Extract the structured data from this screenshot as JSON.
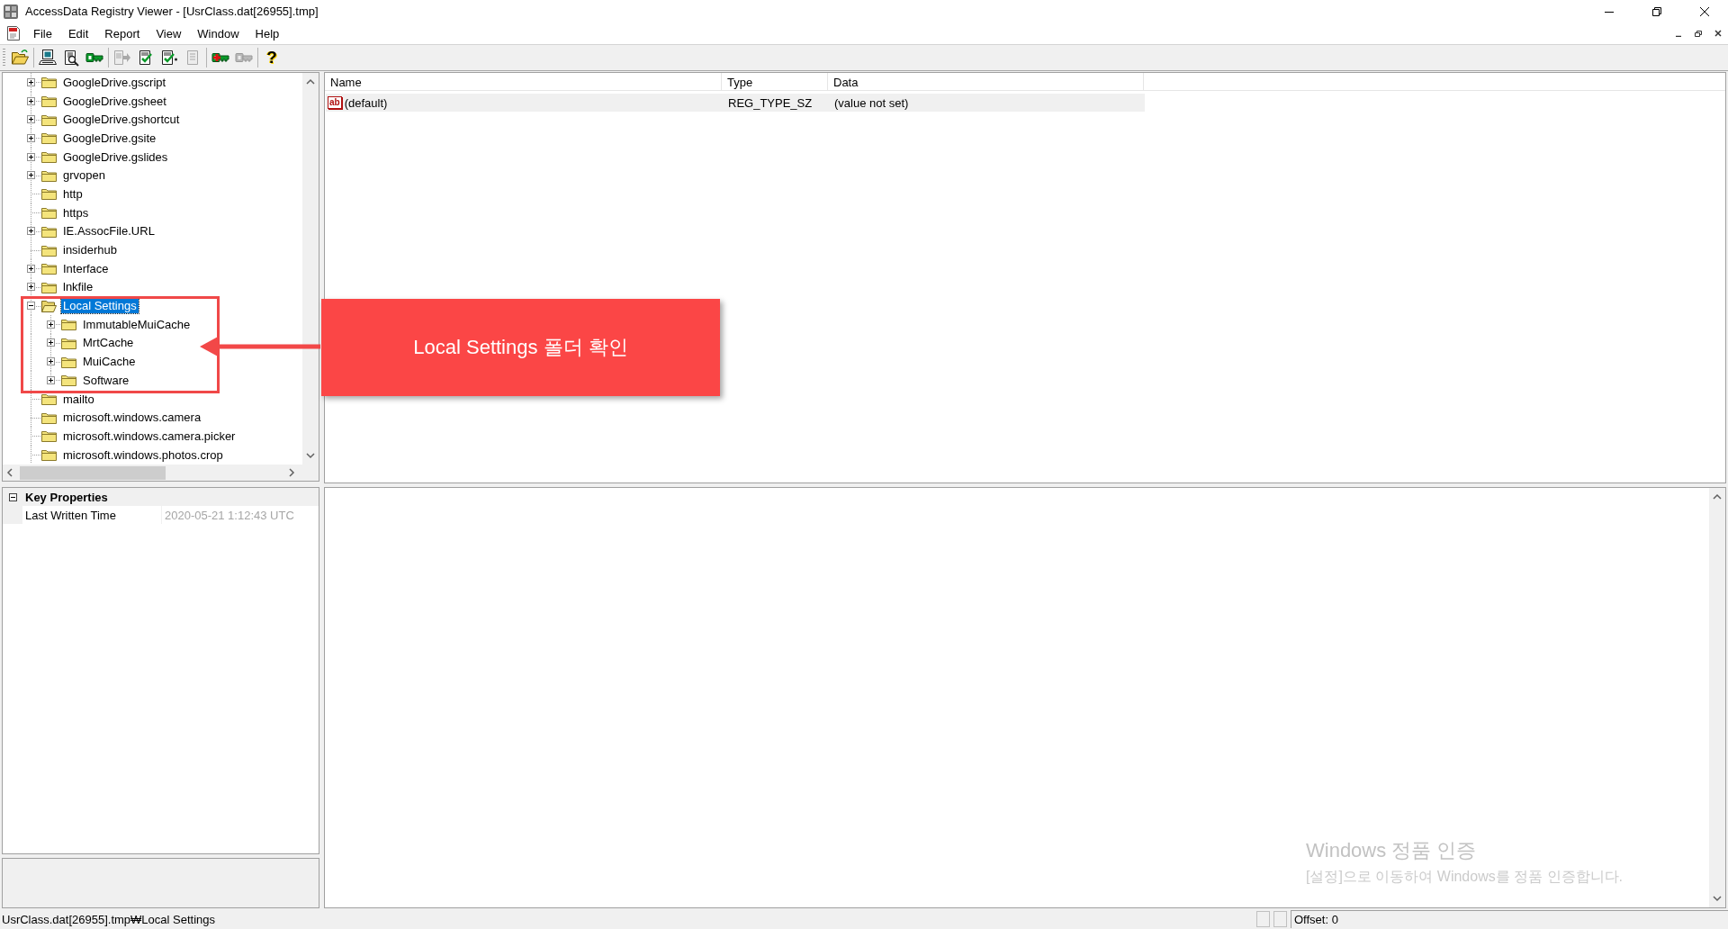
{
  "window": {
    "title": "AccessData Registry Viewer - [UsrClass.dat[26955].tmp]"
  },
  "menu_bar": {
    "items": [
      "File",
      "Edit",
      "Report",
      "View",
      "Window",
      "Help"
    ]
  },
  "toolbar": {
    "groups": [
      [
        {
          "kind": "open",
          "disabled": false
        }
      ],
      [
        {
          "kind": "computer",
          "disabled": false
        },
        {
          "kind": "find",
          "disabled": false
        },
        {
          "kind": "key",
          "disabled": false
        }
      ],
      [
        {
          "kind": "export",
          "disabled": true
        },
        {
          "kind": "check-report",
          "disabled": false
        },
        {
          "kind": "check-report-add",
          "disabled": false
        },
        {
          "kind": "report",
          "disabled": true
        }
      ],
      [
        {
          "kind": "add-key",
          "disabled": false
        },
        {
          "kind": "key",
          "disabled": true
        }
      ],
      [
        {
          "kind": "help",
          "glyph": "?",
          "disabled": false
        }
      ]
    ]
  },
  "tree": {
    "items": [
      {
        "label": "GoogleDrive.gscript",
        "expandable": true,
        "expanded": false,
        "selected": false
      },
      {
        "label": "GoogleDrive.gsheet",
        "expandable": true,
        "expanded": false,
        "selected": false
      },
      {
        "label": "GoogleDrive.gshortcut",
        "expandable": true,
        "expanded": false,
        "selected": false
      },
      {
        "label": "GoogleDrive.gsite",
        "expandable": true,
        "expanded": false,
        "selected": false
      },
      {
        "label": "GoogleDrive.gslides",
        "expandable": true,
        "expanded": false,
        "selected": false
      },
      {
        "label": "grvopen",
        "expandable": true,
        "expanded": false,
        "selected": false
      },
      {
        "label": "http",
        "expandable": false,
        "expanded": false,
        "selected": false
      },
      {
        "label": "https",
        "expandable": false,
        "expanded": false,
        "selected": false
      },
      {
        "label": "IE.AssocFile.URL",
        "expandable": true,
        "expanded": false,
        "selected": false
      },
      {
        "label": "insiderhub",
        "expandable": false,
        "expanded": false,
        "selected": false
      },
      {
        "label": "Interface",
        "expandable": true,
        "expanded": false,
        "selected": false
      },
      {
        "label": "lnkfile",
        "expandable": true,
        "expanded": false,
        "selected": false
      },
      {
        "label": "Local Settings",
        "expandable": true,
        "expanded": true,
        "selected": true,
        "children": [
          {
            "label": "ImmutableMuiCache",
            "expandable": true,
            "expanded": false,
            "selected": false
          },
          {
            "label": "MrtCache",
            "expandable": true,
            "expanded": false,
            "selected": false
          },
          {
            "label": "MuiCache",
            "expandable": true,
            "expanded": false,
            "selected": false
          },
          {
            "label": "Software",
            "expandable": true,
            "expanded": false,
            "selected": false
          }
        ]
      },
      {
        "label": "mailto",
        "expandable": false,
        "expanded": false,
        "selected": false
      },
      {
        "label": "microsoft.windows.camera",
        "expandable": false,
        "expanded": false,
        "selected": false
      },
      {
        "label": "microsoft.windows.camera.picker",
        "expandable": false,
        "expanded": false,
        "selected": false
      },
      {
        "label": "microsoft.windows.photos.crop",
        "expandable": false,
        "expanded": false,
        "selected": false
      }
    ]
  },
  "values_list": {
    "columns": [
      "Name",
      "Type",
      "Data"
    ],
    "rows": [
      {
        "kind": "string",
        "icon_text": "ab",
        "name": "(default)",
        "type": "REG_TYPE_SZ",
        "data": "(value not set)",
        "selected": true
      }
    ]
  },
  "properties": {
    "categories": [
      {
        "title": "Key Properties",
        "expanded": true,
        "rows": [
          {
            "label": "Last Written Time",
            "value": "2020-05-21 1:12:43 UTC",
            "read_only": true
          }
        ]
      }
    ]
  },
  "status_bar": {
    "path": "UsrClass.dat[26955].tmp₩Local Settings",
    "offset": "Offset: 0"
  },
  "annotation": {
    "text": "Local Settings 폴더 확인"
  },
  "activation_watermark": {
    "title": "Windows 정품 인증",
    "message": "[설정]으로 이동하여 Windows를 정품 인증합니다."
  }
}
